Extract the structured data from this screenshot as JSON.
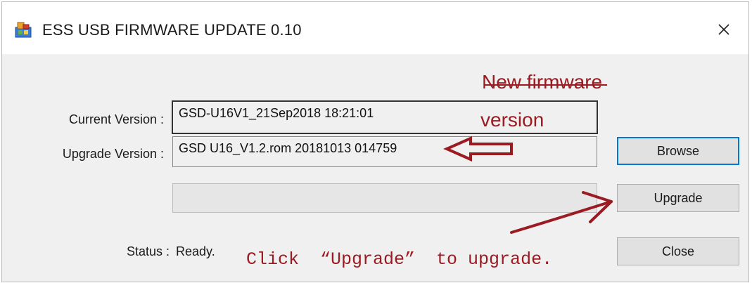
{
  "window": {
    "title": "ESS USB FIRMWARE UPDATE 0.10",
    "close_glyph": "✕",
    "app_icon": "installer-icon"
  },
  "form": {
    "current_version_label": "Current Version :",
    "current_version_value": "GSD-U16V1_21Sep2018 18:21:01",
    "upgrade_version_label": "Upgrade Version :",
    "upgrade_version_value": "GSD U16_V1.2.rom 20181013 014759",
    "progress_percent": 0,
    "status_label": "Status :",
    "status_value": "Ready."
  },
  "buttons": {
    "browse": "Browse",
    "upgrade": "Upgrade",
    "close": "Close"
  },
  "annotations": {
    "new_firmware_line1": "New firmware",
    "new_firmware_line2": "version",
    "click_hint": "Click  “Upgrade”  to upgrade.",
    "color": "#9b1b22"
  }
}
